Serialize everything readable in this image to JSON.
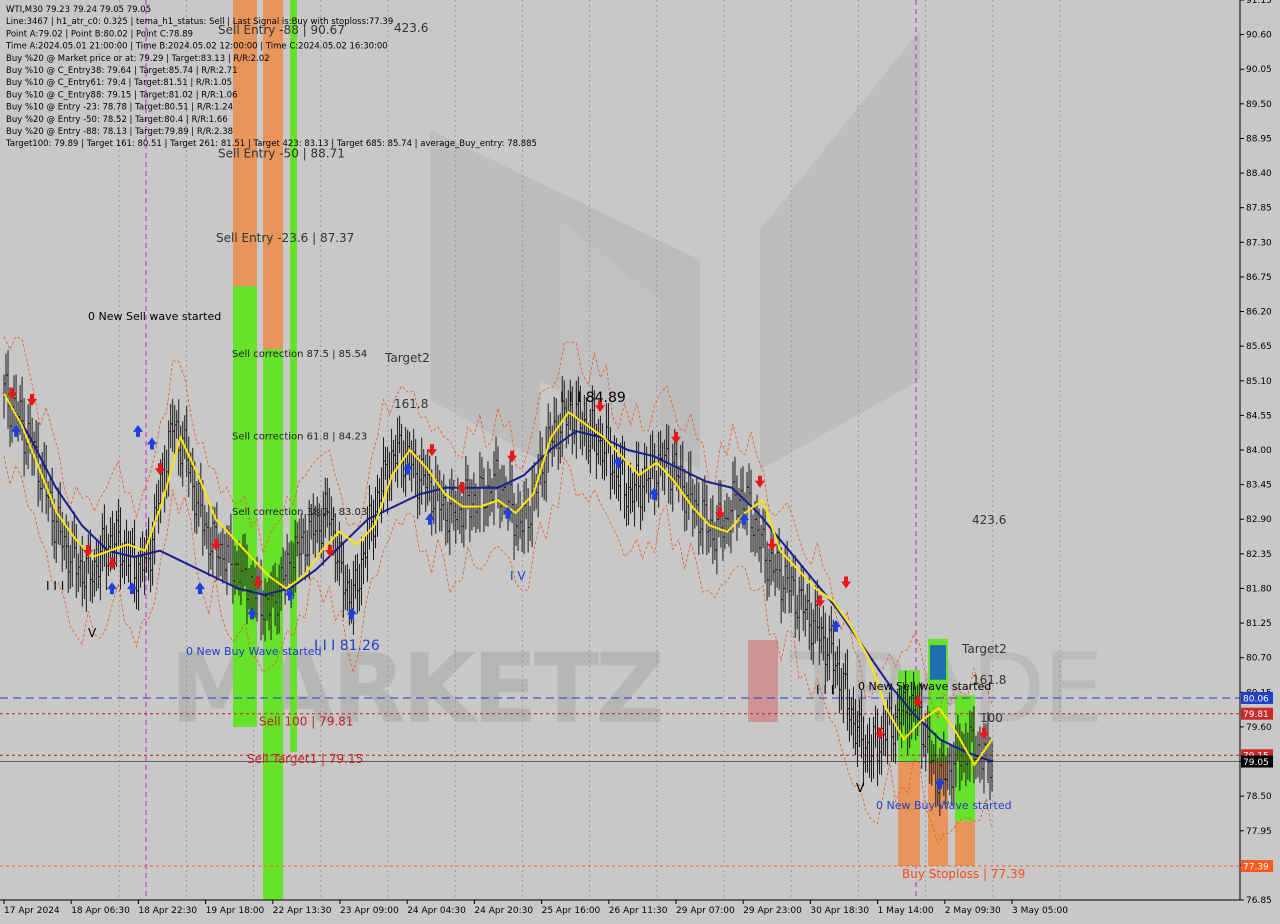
{
  "header": {
    "lines": [
      "WTI,M30  79.23 79.24 79.05 79.05",
      "Line:3467 | h1_atr_c0: 0.325 | tema_h1_status: Sell | Last Signal is:Buy with stoploss:77.39",
      "Point A:79.02 | Point B:80.02 | Point C:78.89",
      "Time A:2024.05.01 21:00:00 | Time B:2024.05.02 12:00:00 | Time C:2024.05.02 16:30:00",
      "Buy %20 @ Market price or at: 79.29 | Target:83.13 | R/R:2.02",
      "Buy %10 @ C_Entry38: 79.64 | Target:85.74 | R/R:2.71",
      "Buy %10 @ C_Entry61: 79.4 | Target:81.51 | R/R:1.05",
      "Buy %10 @ C_Entry88: 79.15 | Target:81.02 | R/R:1.06",
      "Buy %10 @ Entry -23: 78.78 | Target:80.51 | R/R:1.24",
      "Buy %20 @ Entry -50: 78.52 | Target:80.4 | R/R:1.66",
      "Buy %20 @ Entry -88: 78.13 | Target:79.89 | R/R:2.38",
      "Target100: 79.89 | Target 161: 80.51 | Target 261: 81.51 | Target 423: 83.13 | Target 685: 85.74 | average_Buy_entry: 78.885"
    ]
  },
  "chart_data": {
    "type": "candlestick",
    "symbol": "WTI",
    "timeframe": "M30",
    "last_close": 79.05,
    "ylim": [
      76.85,
      91.15
    ],
    "y_ticks": [
      91.15,
      90.6,
      90.05,
      89.5,
      88.95,
      88.4,
      87.85,
      87.3,
      86.75,
      86.2,
      85.65,
      85.1,
      84.55,
      84.0,
      83.45,
      82.9,
      82.35,
      81.8,
      81.25,
      80.7,
      80.15,
      79.6,
      79.05,
      78.5,
      77.95,
      77.4,
      76.85
    ],
    "x_ticks": [
      "17 Apr 2024",
      "18 Apr 06:30",
      "18 Apr 22:30",
      "19 Apr 18:00",
      "22 Apr 13:30",
      "23 Apr 09:00",
      "24 Apr 04:30",
      "24 Apr 20:30",
      "25 Apr 16:00",
      "26 Apr 11:30",
      "29 Apr 07:00",
      "29 Apr 23:00",
      "30 Apr 18:30",
      "1 May 14:00",
      "2 May 09:30",
      "3 May 05:00"
    ],
    "price_markers": [
      {
        "value": 80.06,
        "color": "#1f3fc6"
      },
      {
        "value": 79.81,
        "color": "#cc2a2a"
      },
      {
        "value": 79.15,
        "color": "#cc2a2a"
      },
      {
        "value": 79.05,
        "color": "#000000"
      },
      {
        "value": 77.39,
        "color": "#ff5a1e"
      }
    ],
    "levels": [
      {
        "label": "Sell 100 | 79.81",
        "value": 79.81
      },
      {
        "label": "Sell Target1 | 79.15",
        "value": 79.15
      },
      {
        "label": "Buy Stoploss | 77.39",
        "value": 77.39
      }
    ],
    "zone_labels": [
      {
        "label": "Sell Entry -88 | 90.67",
        "value": 90.67
      },
      {
        "label": "Sell Entry -50 | 88.71",
        "value": 88.71
      },
      {
        "label": "Sell Entry -23.6 | 87.37",
        "value": 87.37
      },
      {
        "label": "Sell correction 87.5 | 85.54",
        "value": 85.54
      },
      {
        "label": "Sell correction 61.8 | 84.23",
        "value": 84.23
      },
      {
        "label": "Sell correction 38.2 | 83.03",
        "value": 83.03
      }
    ],
    "annotations": [
      "423.6",
      "Target2",
      "161.8",
      "0 New Sell wave started",
      "0 New Buy Wave started",
      "I I I 81.26",
      "I I I 84.89",
      "I V",
      "I I I",
      "V",
      "423.6",
      "Target2",
      "161.8",
      "100",
      "0 New Sell wave started",
      "0 New Buy Wave started",
      "I I I",
      "V"
    ],
    "close_series": [
      84.9,
      84.6,
      84.2,
      83.7,
      83.0,
      82.5,
      82.2,
      82.0,
      82.3,
      82.6,
      82.4,
      82.1,
      82.3,
      83.4,
      84.4,
      84.0,
      83.2,
      82.6,
      82.4,
      82.2,
      82.0,
      81.7,
      81.5,
      81.9,
      82.3,
      82.6,
      82.8,
      83.0,
      82.0,
      81.6,
      82.5,
      83.2,
      83.8,
      84.0,
      83.7,
      83.5,
      83.2,
      83.0,
      83.1,
      83.2,
      83.3,
      83.5,
      83.1,
      82.8,
      83.3,
      84.0,
      84.4,
      84.6,
      84.4,
      84.2,
      84.0,
      83.6,
      83.3,
      83.5,
      83.7,
      83.8,
      83.6,
      83.2,
      82.9,
      82.7,
      82.9,
      83.3,
      83.0,
      82.4,
      82.1,
      81.9,
      81.6,
      81.3,
      81.0,
      80.6,
      80.0,
      79.4,
      79.2,
      79.5,
      79.7,
      79.9,
      79.8,
      79.0,
      78.8,
      79.1,
      79.3,
      79.2,
      79.05
    ],
    "signal_line": [
      84.9,
      84.4,
      83.7,
      83.0,
      82.6,
      82.3,
      82.4,
      82.5,
      82.4,
      83.2,
      84.2,
      83.6,
      82.9,
      82.6,
      82.3,
      82.0,
      81.8,
      82.0,
      82.4,
      82.7,
      82.5,
      82.8,
      83.6,
      84.0,
      83.7,
      83.3,
      83.1,
      83.1,
      83.2,
      83.0,
      83.3,
      84.2,
      84.6,
      84.4,
      84.2,
      83.9,
      83.6,
      83.8,
      83.5,
      83.1,
      82.8,
      82.7,
      83.0,
      83.2,
      82.4,
      82.1,
      81.8,
      81.6,
      81.2,
      80.7,
      79.9,
      79.4,
      79.7,
      79.9,
      79.5,
      79.0,
      79.4
    ],
    "ma_series": [
      84.9,
      84.2,
      83.4,
      82.8,
      82.4,
      82.3,
      82.4,
      82.2,
      82.0,
      81.8,
      81.7,
      81.8,
      82.1,
      82.5,
      82.9,
      83.1,
      83.3,
      83.4,
      83.4,
      83.4,
      83.6,
      84.0,
      84.3,
      84.2,
      84.0,
      83.9,
      83.7,
      83.5,
      83.4,
      83.0,
      82.5,
      82.0,
      81.5,
      80.9,
      80.3,
      79.8,
      79.4,
      79.2,
      79.05
    ]
  }
}
